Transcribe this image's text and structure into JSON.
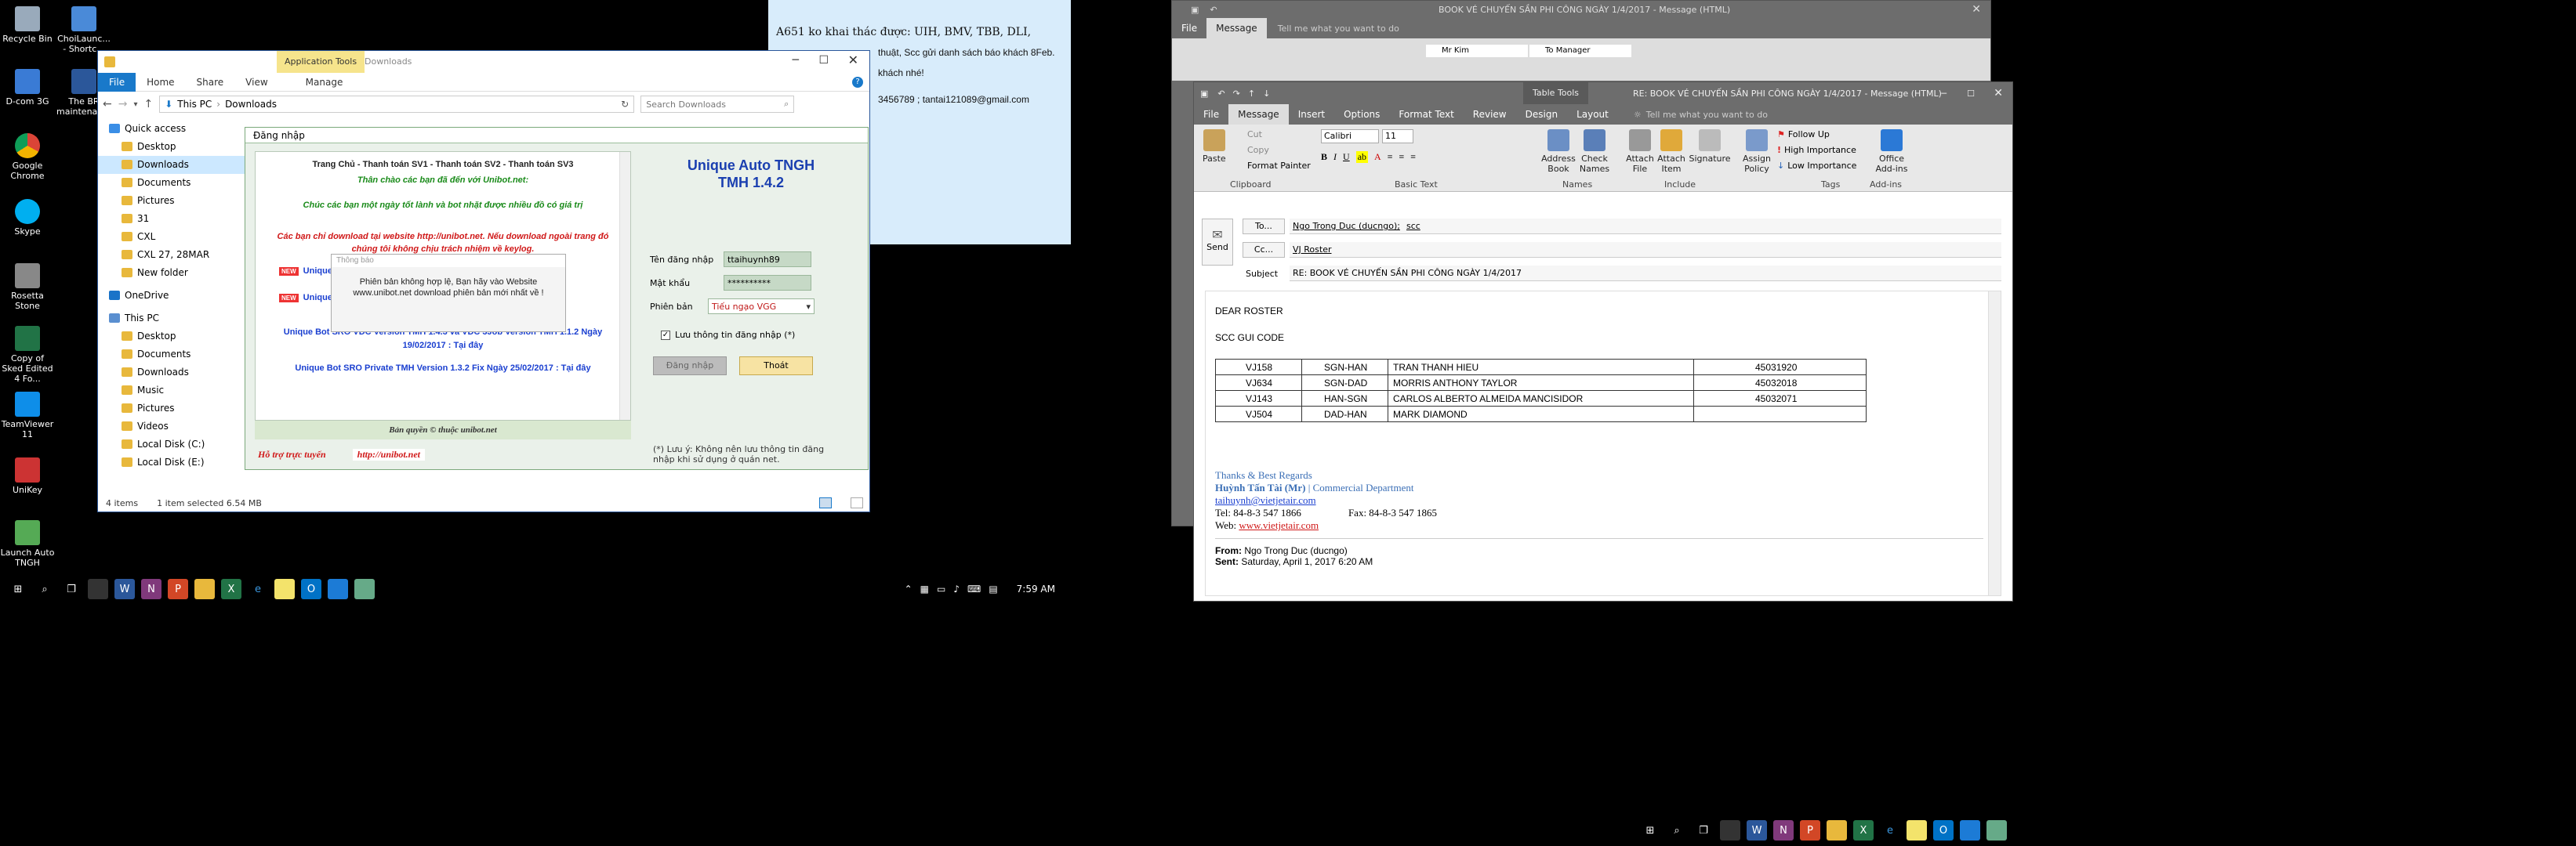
{
  "desktop": {
    "icons": [
      {
        "label": "Recycle Bin"
      },
      {
        "label": "ChoiLaunc... - Shortc..."
      },
      {
        "label": "The BR maintenance"
      },
      {
        "label": "D-com 3G"
      },
      {
        "label": "Google Chrome"
      },
      {
        "label": "Skype"
      },
      {
        "label": "Rosetta Stone"
      },
      {
        "label": "Copy of Sked Edited 4 Fo..."
      },
      {
        "label": "TeamViewer 11"
      },
      {
        "label": "UniKey"
      },
      {
        "label": "Launch Auto TNGH"
      }
    ],
    "note": {
      "line1": "A651 ko khai thác được: UIH, BMV, TBB, DLI,",
      "line2": "thuật, Scc gửi danh sách báo khách 8Feb.",
      "line3": "khách nhé!",
      "line4": "3456789 ; tantai121089@gmail.com"
    }
  },
  "taskbar_left": {
    "clock": "7:59 AM"
  },
  "explorer": {
    "title": "Downloads",
    "context_tab": "Application Tools",
    "tabs": [
      "File",
      "Home",
      "Share",
      "View",
      "Manage"
    ],
    "breadcrumb": [
      "This PC",
      "Downloads"
    ],
    "search_placeholder": "Search Downloads",
    "nav": [
      {
        "label": "Quick access",
        "level": 0
      },
      {
        "label": "Desktop",
        "level": 1
      },
      {
        "label": "Downloads",
        "level": 1,
        "selected": true
      },
      {
        "label": "Documents",
        "level": 1
      },
      {
        "label": "Pictures",
        "level": 1
      },
      {
        "label": "31",
        "level": 1
      },
      {
        "label": "CXL",
        "level": 1
      },
      {
        "label": "CXL 27, 28MAR",
        "level": 1
      },
      {
        "label": "New folder",
        "level": 1
      },
      {
        "label": "OneDrive",
        "level": 0
      },
      {
        "label": "This PC",
        "level": 0
      },
      {
        "label": "Desktop",
        "level": 1
      },
      {
        "label": "Documents",
        "level": 1
      },
      {
        "label": "Downloads",
        "level": 1
      },
      {
        "label": "Music",
        "level": 1
      },
      {
        "label": "Pictures",
        "level": 1
      },
      {
        "label": "Videos",
        "level": 1
      },
      {
        "label": "Local Disk (C:)",
        "level": 1
      },
      {
        "label": "Local Disk (E:)",
        "level": 1
      }
    ],
    "status": {
      "items": "4 items",
      "selected": "1 item selected  6.54 MB"
    }
  },
  "dialog": {
    "title": "Đăng nhập",
    "menu": "Trang Chủ - Thanh toán SV1 - Thanh toán SV2 - Thanh toán SV3",
    "welcome": "Thân chào các bạn đã đến với Unibot.net:",
    "wish": "Chúc các bạn một ngày tốt lành và bot nhặt được nhiều đồ có giá trị",
    "warn": "Các bạn chỉ download tại website http://unibot.net. Nếu download ngoài trang đó chúng tôi không chịu trách nhiệm về keylog.",
    "item_new": "NEW",
    "item_label": "Unique Auto",
    "popup_title": "Thông báo",
    "popup_text": "Phiên bản không hợp lệ, Bạn hãy vào Website www.unibot.net download phiên bản mới nhất về  !",
    "vdc": "Unique Bot SRO VDC Version TMH 1.4.3 và VDC 3Job Version TMH 1.1.2 Ngày 19/02/2017 : Tại đây",
    "private": "Unique Bot SRO Private TMH Version 1.3.2 Fix Ngày 25/02/2017 : Tại đây",
    "copyright": "Bản quyền © thuộc unibot.net",
    "support": "Hỗ trợ trực tuyến",
    "site": "http://unibot.net",
    "app_title": "Unique Auto TNGH",
    "app_version": "TMH 1.4.2",
    "user_label": "Tên đăng nhập",
    "user_value": "ttaihuynh89",
    "pass_label": "Mật khẩu",
    "pass_value": "**********",
    "ver_label": "Phiên bản",
    "ver_value": "Tiếu ngạo VGG",
    "remember": "Lưu thông tin đăng nhập (*)",
    "login_btn": "Đăng nhập",
    "exit_btn": "Thoát",
    "footnote": "(*) Lưu ý:  Không nên lưu thông tin đăng nhập khi sử dụng ở quán net."
  },
  "outlook_back": {
    "title": "BOOK VÉ CHUYẾN SẦN PHI CÔNG NGÀY 1/4/2017 - Message (HTML)",
    "tabs": [
      "File",
      "Message"
    ],
    "tell_me": "Tell me what you want to do",
    "quick1": "Mr Kim",
    "quick2": "To Manager"
  },
  "outlook": {
    "title": "RE: BOOK VÉ CHUYẾN SẦN PHI CÔNG NGÀY 1/4/2017 - Message (HTML)",
    "context_tab": "Table Tools",
    "tabs": [
      "File",
      "Message",
      "Insert",
      "Options",
      "Format Text",
      "Review",
      "Design",
      "Layout"
    ],
    "tell_me": "Tell me what you want to do",
    "clipboard": {
      "paste": "Paste",
      "cut": "Cut",
      "copy": "Copy",
      "painter": "Format Painter",
      "label": "Clipboard"
    },
    "basic_text": {
      "font": "Calibri",
      "size": "11",
      "label": "Basic Text"
    },
    "names": {
      "address": "Address Book",
      "check": "Check Names",
      "label": "Names"
    },
    "include": {
      "file": "Attach File",
      "item": "Attach Item",
      "sig": "Signature",
      "label": "Include"
    },
    "tags": {
      "policy": "Assign Policy",
      "follow": "Follow Up",
      "high": "High Importance",
      "low": "Low Importance",
      "label": "Tags"
    },
    "addins": {
      "office": "Office Add-ins",
      "label": "Add-ins"
    },
    "send": "Send",
    "to_label": "To...",
    "to_value": "Ngo Trong Duc (ducngo);",
    "to_extra": "scc",
    "cc_label": "Cc...",
    "cc_value": "VJ Roster",
    "subject_label": "Subject",
    "subject_value": "RE: BOOK VÉ CHUYẾN SẦN PHI CÔNG NGÀY 1/4/2017",
    "greeting": "DEAR ROSTER",
    "line": "SCC GUI CODE",
    "rows": [
      {
        "flight": "VJ158",
        "route": "SGN-HAN",
        "name": "TRAN THANH HIEU",
        "code": "45031920"
      },
      {
        "flight": "VJ634",
        "route": "SGN-DAD",
        "name": "MORRIS ANTHONY TAYLOR",
        "code": "45032018"
      },
      {
        "flight": "VJ143",
        "route": "HAN-SGN",
        "name": "CARLOS ALBERTO ALMEIDA MANCISIDOR",
        "code": "45032071"
      },
      {
        "flight": "VJ504",
        "route": "DAD-HAN",
        "name": "MARK DIAMOND",
        "code": ""
      }
    ],
    "thanks": "Thanks & Best Regards",
    "sig_name": "Huỳnh Tấn Tài (Mr)",
    "sig_dept": "Commercial Department",
    "sig_email": "taihuynh@vietjetair.com",
    "sig_tel": "Tel: 84-8-3 547 1866",
    "sig_fax": "Fax: 84-8-3 547 1865",
    "sig_web_label": "Web:",
    "sig_web": "www.vietjetair.com",
    "from_label": "From:",
    "from_value": "Ngo Trong Duc (ducngo)",
    "sent_label": "Sent:",
    "sent_value": "Saturday, April 1, 2017 6:20 AM"
  }
}
